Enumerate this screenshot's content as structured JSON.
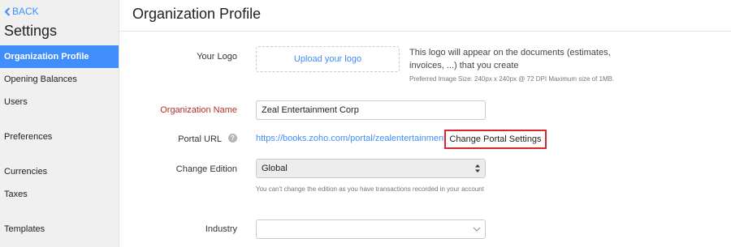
{
  "sidebar": {
    "back_label": "BACK",
    "title": "Settings",
    "items": [
      {
        "label": "Organization Profile",
        "active": true
      },
      {
        "label": "Opening Balances",
        "active": false
      },
      {
        "label": "Users",
        "active": false
      },
      {
        "label": "Preferences",
        "active": false
      },
      {
        "label": "Currencies",
        "active": false
      },
      {
        "label": "Taxes",
        "active": false
      },
      {
        "label": "Templates",
        "active": false
      }
    ]
  },
  "header": {
    "title": "Organization Profile"
  },
  "form": {
    "logo": {
      "label": "Your Logo",
      "upload_label": "Upload your logo",
      "note": "This logo will appear on the documents (estimates, invoices, ...) that you create",
      "hint": "Preferred Image Size: 240px x 240px @ 72 DPI Maximum size of 1MB."
    },
    "org_name": {
      "label": "Organization Name",
      "value": "Zeal Entertainment Corp"
    },
    "portal": {
      "label": "Portal URL",
      "url": "https://books.zoho.com/portal/zealentertainment",
      "button_label": "Change Portal Settings"
    },
    "edition": {
      "label": "Change Edition",
      "value": "Global",
      "note": "You can't change the edition as you have transactions recorded in your account"
    },
    "industry": {
      "label": "Industry",
      "value": ""
    }
  },
  "colors": {
    "accent": "#408dfb",
    "required": "#b33125",
    "highlight": "#d9262c"
  }
}
